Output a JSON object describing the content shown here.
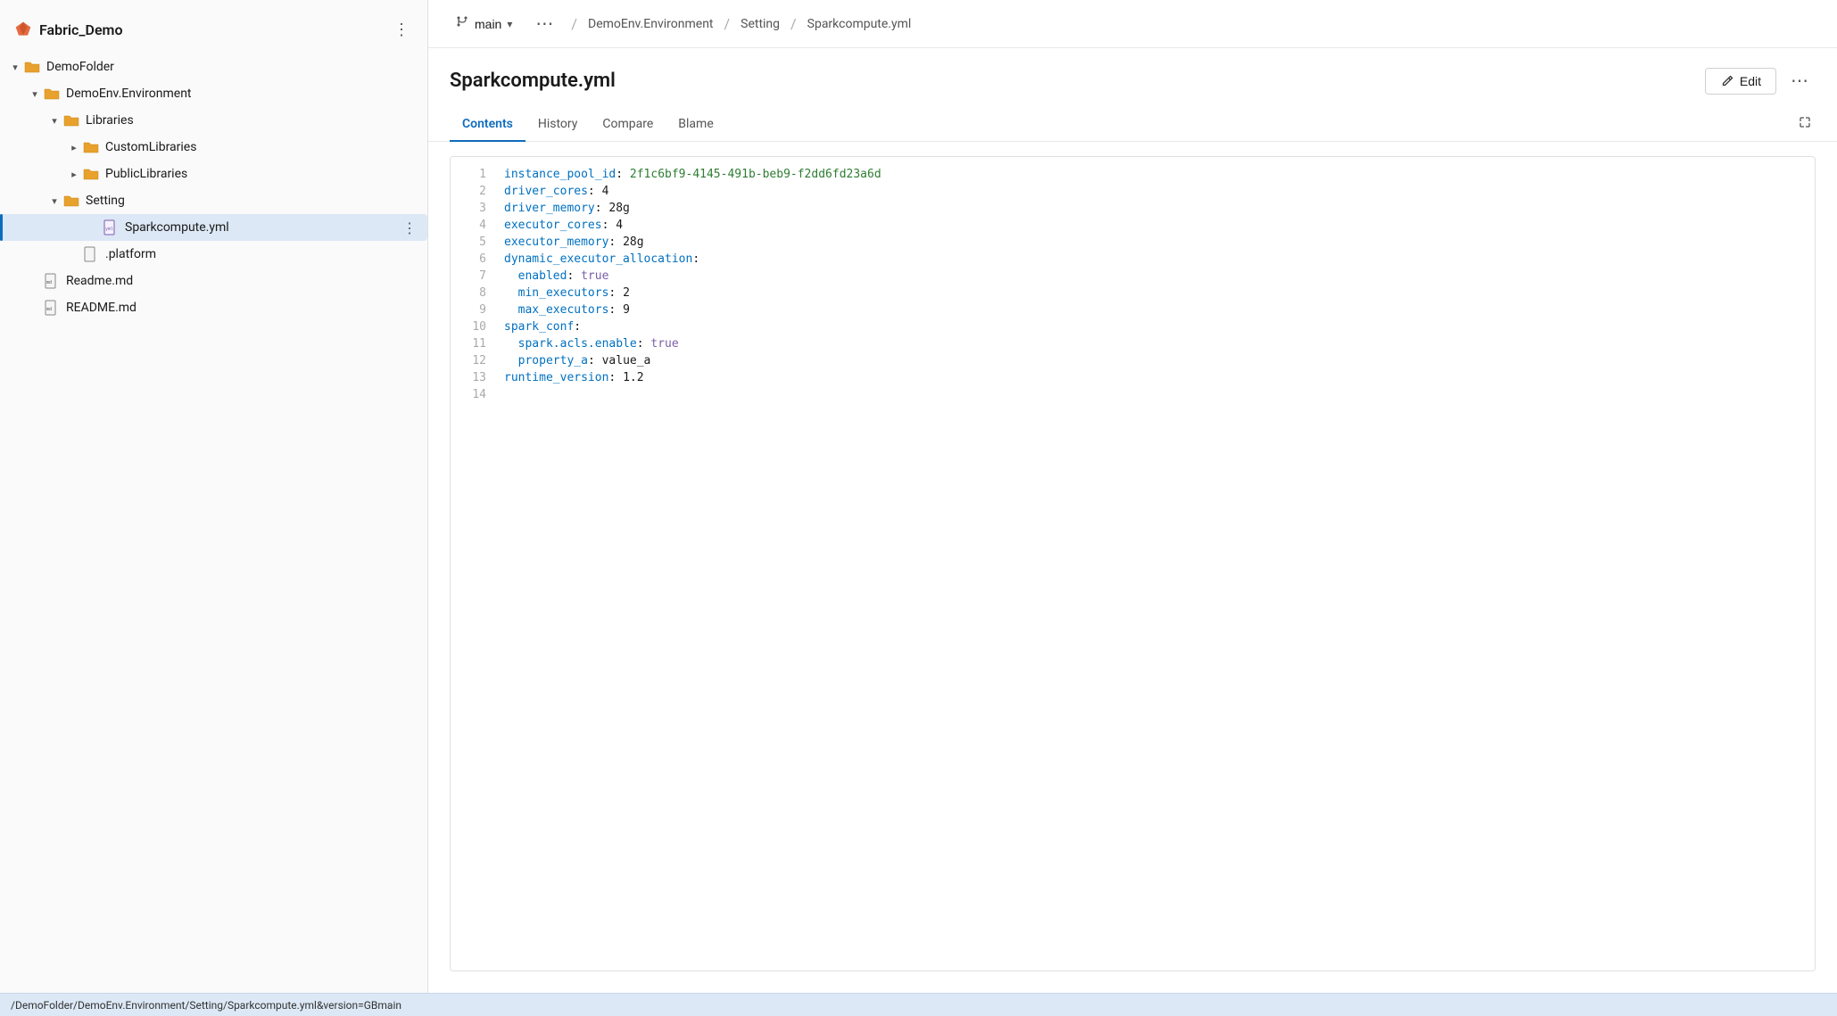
{
  "app": {
    "title": "Fabric_Demo",
    "more_label": "⋮"
  },
  "sidebar": {
    "items": [
      {
        "id": "demofolder",
        "label": "DemoFolder",
        "type": "folder",
        "indent": 0,
        "expanded": true,
        "chevron": "down"
      },
      {
        "id": "demoenv",
        "label": "DemoEnv.Environment",
        "type": "folder",
        "indent": 1,
        "expanded": true,
        "chevron": "down"
      },
      {
        "id": "libraries",
        "label": "Libraries",
        "type": "folder",
        "indent": 2,
        "expanded": true,
        "chevron": "down"
      },
      {
        "id": "customlibraries",
        "label": "CustomLibraries",
        "type": "folder",
        "indent": 3,
        "expanded": false,
        "chevron": "right"
      },
      {
        "id": "publiclibraries",
        "label": "PublicLibraries",
        "type": "folder",
        "indent": 3,
        "expanded": false,
        "chevron": "right"
      },
      {
        "id": "setting",
        "label": "Setting",
        "type": "folder",
        "indent": 2,
        "expanded": true,
        "chevron": "down"
      },
      {
        "id": "sparkcompute",
        "label": "Sparkcompute.yml",
        "type": "yml",
        "indent": 4,
        "active": true
      },
      {
        "id": "platform",
        "label": ".platform",
        "type": "file",
        "indent": 3
      },
      {
        "id": "readmemd",
        "label": "Readme.md",
        "type": "md",
        "indent": 1
      },
      {
        "id": "readMEmd",
        "label": "README.md",
        "type": "md",
        "indent": 1
      }
    ]
  },
  "topbar": {
    "branch_name": "main",
    "branch_icon": "⑂",
    "breadcrumb": [
      {
        "label": "DemoEnv.Environment"
      },
      {
        "label": "Setting"
      },
      {
        "label": "Sparkcompute.yml"
      }
    ]
  },
  "file": {
    "title": "Sparkcompute.yml",
    "edit_label": "Edit",
    "tabs": [
      {
        "id": "contents",
        "label": "Contents",
        "active": true
      },
      {
        "id": "history",
        "label": "History",
        "active": false
      },
      {
        "id": "compare",
        "label": "Compare",
        "active": false
      },
      {
        "id": "blame",
        "label": "Blame",
        "active": false
      }
    ],
    "code_lines": [
      {
        "num": 1,
        "tokens": [
          {
            "t": "key",
            "v": "instance_pool_id"
          },
          {
            "t": "colon",
            "v": ": "
          },
          {
            "t": "val-str",
            "v": "2f1c6bf9-4145-491b-beb9-f2dd6fd23a6d"
          }
        ]
      },
      {
        "num": 2,
        "tokens": [
          {
            "t": "key",
            "v": "driver_cores"
          },
          {
            "t": "colon",
            "v": ": "
          },
          {
            "t": "val-num",
            "v": "4"
          }
        ]
      },
      {
        "num": 3,
        "tokens": [
          {
            "t": "key",
            "v": "driver_memory"
          },
          {
            "t": "colon",
            "v": ": "
          },
          {
            "t": "val-num",
            "v": "28g"
          }
        ]
      },
      {
        "num": 4,
        "tokens": [
          {
            "t": "key",
            "v": "executor_cores"
          },
          {
            "t": "colon",
            "v": ": "
          },
          {
            "t": "val-num",
            "v": "4"
          }
        ]
      },
      {
        "num": 5,
        "tokens": [
          {
            "t": "key",
            "v": "executor_memory"
          },
          {
            "t": "colon",
            "v": ": "
          },
          {
            "t": "val-num",
            "v": "28g"
          }
        ]
      },
      {
        "num": 6,
        "tokens": [
          {
            "t": "key",
            "v": "dynamic_executor_allocation"
          },
          {
            "t": "colon",
            "v": ":"
          }
        ]
      },
      {
        "num": 7,
        "tokens": [
          {
            "t": "indent",
            "v": "  "
          },
          {
            "t": "key",
            "v": "enabled"
          },
          {
            "t": "colon",
            "v": ": "
          },
          {
            "t": "val-bool",
            "v": "true"
          }
        ]
      },
      {
        "num": 8,
        "tokens": [
          {
            "t": "indent",
            "v": "  "
          },
          {
            "t": "key",
            "v": "min_executors"
          },
          {
            "t": "colon",
            "v": ": "
          },
          {
            "t": "val-num",
            "v": "2"
          }
        ]
      },
      {
        "num": 9,
        "tokens": [
          {
            "t": "indent",
            "v": "  "
          },
          {
            "t": "key",
            "v": "max_executors"
          },
          {
            "t": "colon",
            "v": ": "
          },
          {
            "t": "val-num",
            "v": "9"
          }
        ]
      },
      {
        "num": 10,
        "tokens": [
          {
            "t": "key",
            "v": "spark_conf"
          },
          {
            "t": "colon",
            "v": ":"
          }
        ]
      },
      {
        "num": 11,
        "tokens": [
          {
            "t": "indent",
            "v": "  "
          },
          {
            "t": "key",
            "v": "spark.acls.enable"
          },
          {
            "t": "colon",
            "v": ": "
          },
          {
            "t": "val-bool",
            "v": "true"
          }
        ]
      },
      {
        "num": 12,
        "tokens": [
          {
            "t": "indent",
            "v": "  "
          },
          {
            "t": "key",
            "v": "property_a"
          },
          {
            "t": "colon",
            "v": ": "
          },
          {
            "t": "val-num",
            "v": "value_a"
          }
        ]
      },
      {
        "num": 13,
        "tokens": [
          {
            "t": "key",
            "v": "runtime_version"
          },
          {
            "t": "colon",
            "v": ": "
          },
          {
            "t": "val-num",
            "v": "1.2"
          }
        ]
      },
      {
        "num": 14,
        "tokens": []
      }
    ]
  },
  "statusbar": {
    "path": "/DemoFolder/DemoEnv.Environment/Setting/Sparkcompute.yml&version=GBmain"
  }
}
